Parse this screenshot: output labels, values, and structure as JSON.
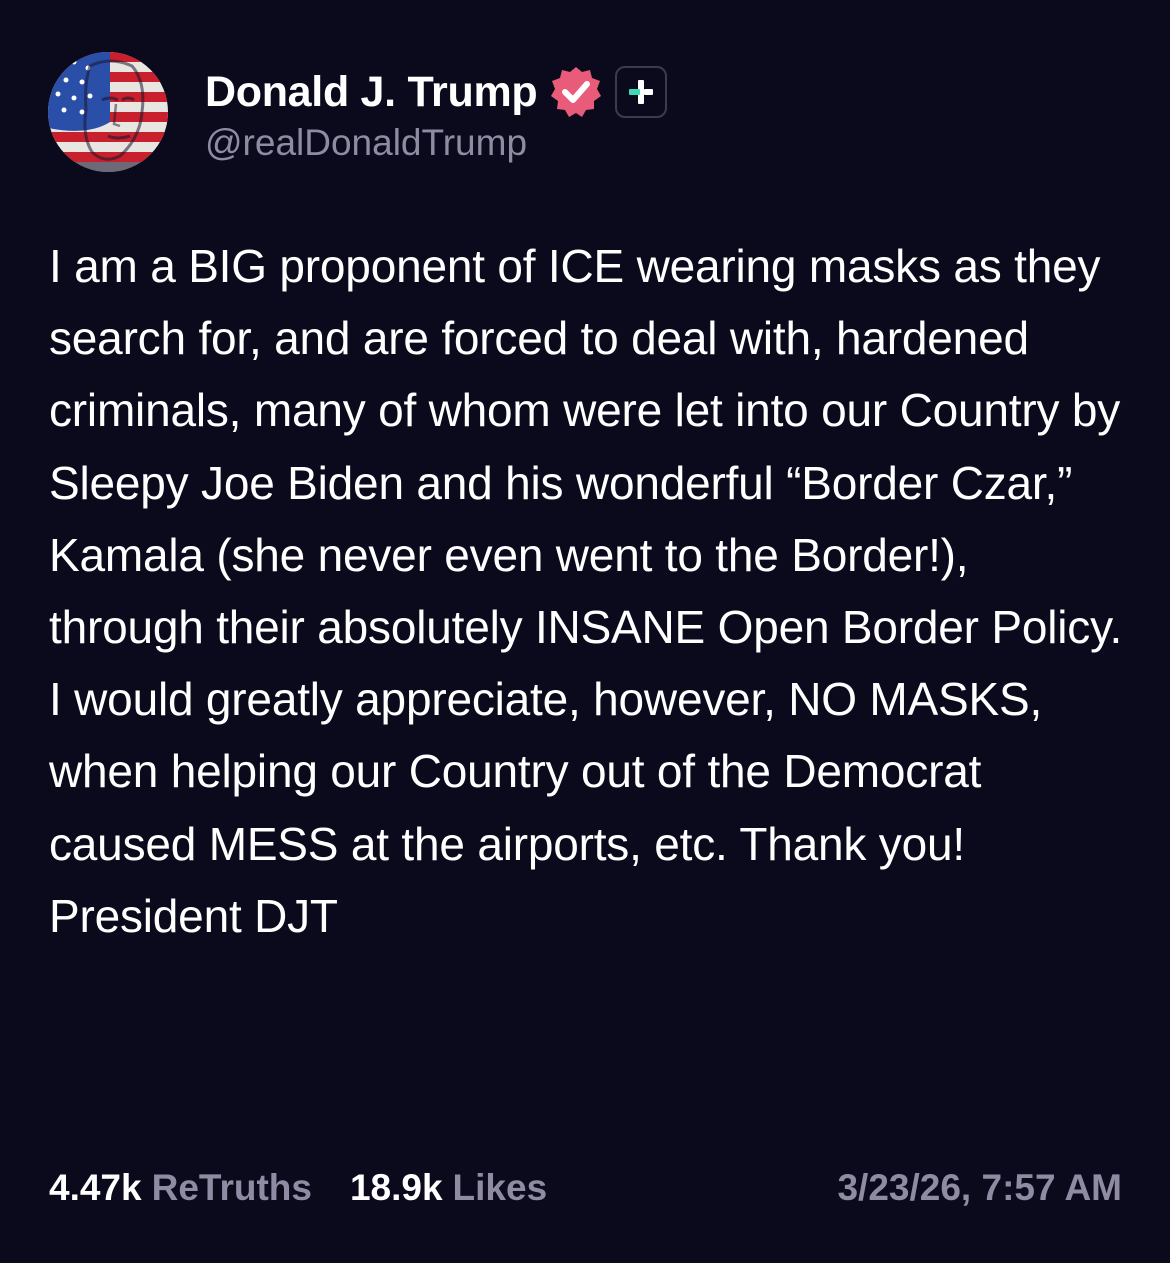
{
  "author": {
    "display_name": "Donald J. Trump",
    "handle": "@realDonaldTrump",
    "avatar_icon": "flag-portrait-avatar",
    "verified_icon": "verified-check-icon",
    "verified_color": "#e85c7a",
    "plus_icon": "plus-icon",
    "plus_icon_color": "#3dd9b0"
  },
  "post": {
    "text": "I am a BIG proponent of ICE wearing masks as they search for, and are forced to deal with, hardened criminals, many of whom were let into our Country by Sleepy Joe Biden and his wonderful “Border Czar,” Kamala (she never even went to the Border!), through their absolutely INSANE Open Border Policy. I would greatly appreciate, however, NO MASKS, when helping our Country out of the Democrat caused MESS at the airports, etc. Thank you! President DJT"
  },
  "stats": {
    "retruths_count": "4.47k",
    "retruths_label": "ReTruths",
    "likes_count": "18.9k",
    "likes_label": "Likes",
    "timestamp": "3/23/26, 7:57 AM"
  },
  "colors": {
    "background": "#0b0a1c",
    "text_primary": "#ffffff",
    "text_secondary": "#8e8ba3"
  }
}
